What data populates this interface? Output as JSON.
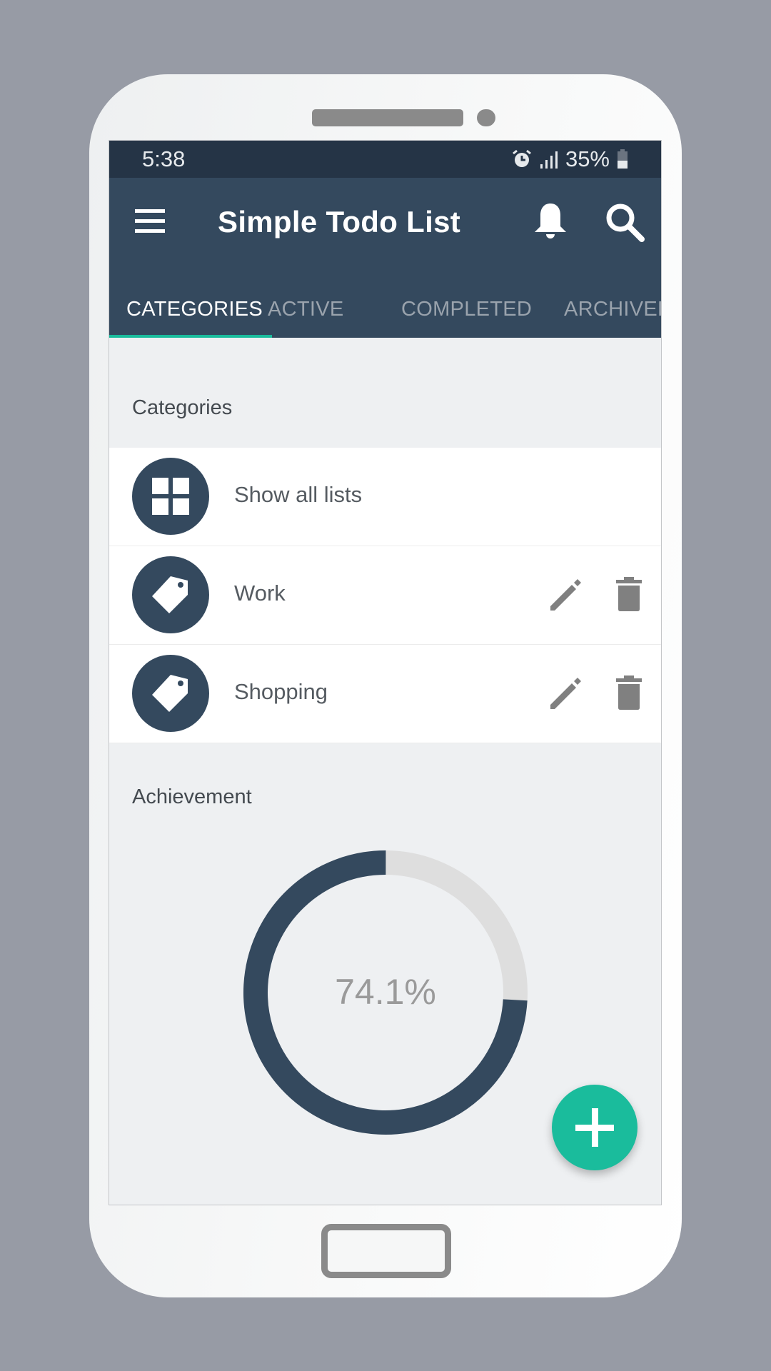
{
  "status_bar": {
    "time": "5:38",
    "battery": "35%",
    "icons": [
      "alarm-icon",
      "signal-icon",
      "battery-icon"
    ]
  },
  "app_bar": {
    "title": "Simple Todo List",
    "icons": [
      "menu-icon",
      "bell-icon",
      "search-icon"
    ]
  },
  "tabs": [
    {
      "label": "CATEGORIES",
      "active": true
    },
    {
      "label": "ACTIVE",
      "active": false
    },
    {
      "label": "COMPLETED",
      "active": false
    },
    {
      "label": "ARCHIVED",
      "active": false
    }
  ],
  "categories": {
    "header": "Categories",
    "items": [
      {
        "label": "Show all lists",
        "icon": "grid-icon",
        "editable": false
      },
      {
        "label": "Work",
        "icon": "tag-icon",
        "editable": true
      },
      {
        "label": "Shopping",
        "icon": "tag-icon",
        "editable": true
      }
    ]
  },
  "achievement": {
    "header": "Achievement",
    "percent_label": "74.1%",
    "value": 0.741
  },
  "fab": {
    "icon": "plus-icon"
  },
  "colors": {
    "primary": "#34495e",
    "accent": "#1abc9c",
    "track": "#dedede"
  }
}
